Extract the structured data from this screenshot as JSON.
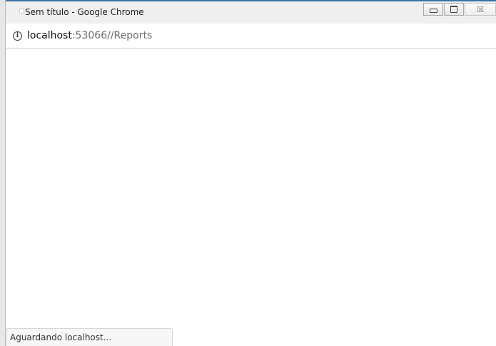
{
  "window": {
    "title": "Sem título - Google Chrome",
    "controls": {
      "minimize_icon": "minimize-icon",
      "maximize_icon": "maximize-icon",
      "close_glyph": "☒"
    }
  },
  "address_bar": {
    "info_glyph": "i",
    "url_host": "localhost",
    "url_rest": ":53066//Reports"
  },
  "status": {
    "text": "Aguardando localhost..."
  },
  "colors": {
    "title_border": "#3a74a8",
    "titlebar_bg": "#efefef",
    "content_bg": "#ffffff"
  }
}
